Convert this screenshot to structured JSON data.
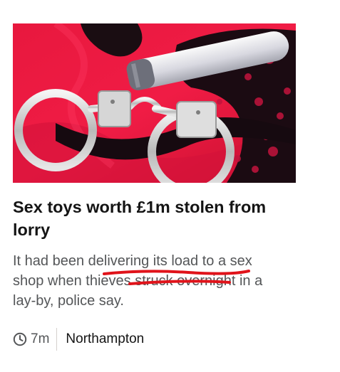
{
  "article": {
    "image_alt": "Handcuffs, lingerie and a sex toy on a red satin background",
    "headline": "Sex toys worth £1m stolen from lorry",
    "summary": "It had been delivering its load to a sex shop when thieves struck overnight in a lay-by, police say.",
    "meta": {
      "time_icon": "clock-icon",
      "time": "7m",
      "location": "Northampton"
    }
  },
  "annotation": {
    "underline_color": "#e0131a"
  }
}
